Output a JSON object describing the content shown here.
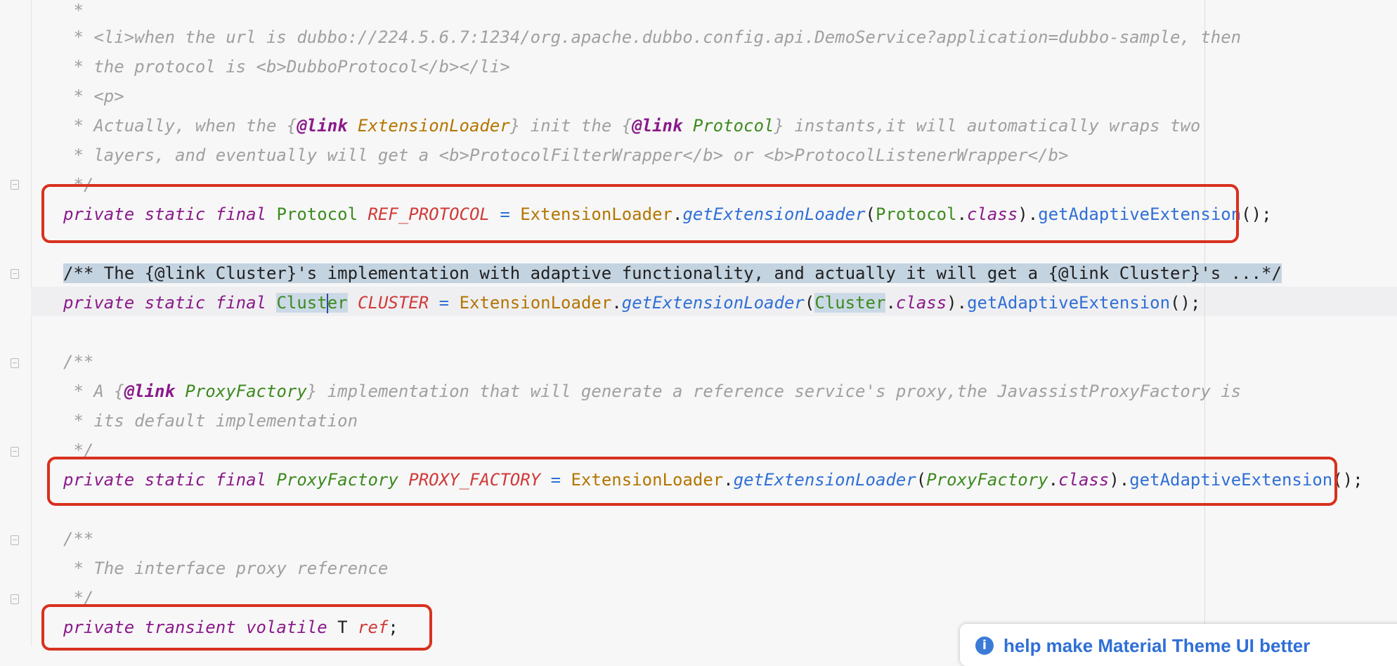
{
  "editor": {
    "lines": {
      "l1": {
        "text": " *"
      },
      "l2": {
        "text": " * <li>when the url is dubbo://224.5.6.7:1234/org.apache.dubbo.config.api.DemoService?application=dubbo-sample, then"
      },
      "l3": {
        "text": " * the protocol is <b>DubboProtocol</b></li>"
      },
      "l4": {
        "text": " * <p>"
      },
      "l5": {
        "a": " * Actually, when the {",
        "link1": "@link",
        "cls1": " ExtensionLoader",
        "b": "} init the {",
        "link2": "@link",
        "cls2": " Protocol",
        "c": "} instants,it will automatically wraps two"
      },
      "l6": {
        "text": " * layers, and eventually will get a <b>ProtocolFilterWrapper</b> or <b>ProtocolListenerWrapper</b>"
      },
      "l7": {
        "text": " */"
      },
      "l8": {
        "kw": "private static final",
        "type": "Protocol",
        "const": "REF_PROTOCOL",
        "eq": "=",
        "cls": "ExtensionLoader",
        "dot1": ".",
        "m1": "getExtensionLoader",
        "lp": "(",
        "arg": "Protocol",
        "dot2": ".",
        "classkw": "class",
        "rp": ")",
        "dot3": ".",
        "m2": "getAdaptiveExtension",
        "end": "();"
      },
      "l9": {
        "text": "/** The {@link Cluster}'s implementation with adaptive functionality, and actually it will get a {@link Cluster}'s ...*/"
      },
      "l10": {
        "kw": "private static final",
        "type_a": "Clust",
        "type_b": "er",
        "const": "CLUSTER",
        "eq": "=",
        "cls": "ExtensionLoader",
        "dot1": ".",
        "m1": "getExtensionLoader",
        "lp": "(",
        "arg": "Cluster",
        "dot2": ".",
        "classkw": "class",
        "rp": ")",
        "dot3": ".",
        "m2": "getAdaptiveExtension",
        "end": "();"
      },
      "l11": {
        "text": "/**"
      },
      "l12": {
        "a": " * A {",
        "link": "@link",
        "cls": " ProxyFactory",
        "b": "} implementation that will generate a reference service's proxy,the JavassistProxyFactory is"
      },
      "l13": {
        "text": " * its default implementation"
      },
      "l14": {
        "text": " */"
      },
      "l15": {
        "kw": "private static final",
        "type": "ProxyFactory",
        "const": "PROXY_FACTORY",
        "eq": "=",
        "cls": "ExtensionLoader",
        "dot1": ".",
        "m1": "getExtensionLoader",
        "lp": "(",
        "arg": "ProxyFactory",
        "dot2": ".",
        "classkw": "class",
        "rp": ")",
        "dot3": ".",
        "m2": "getAdaptiveExtension",
        "end": "();"
      },
      "l16": {
        "text": "/**"
      },
      "l17": {
        "text": " * The interface proxy reference"
      },
      "l18": {
        "text": " */"
      },
      "l19": {
        "kw": "private transient volatile",
        "type": "T",
        "name": "ref",
        "end": ";"
      }
    }
  },
  "notification": {
    "icon": "info-icon",
    "text": "help make Material Theme UI better"
  },
  "colors": {
    "highlight_box": "#d8311f",
    "keyword": "#8a1a8a",
    "type": "#3d8a1f",
    "constant": "#d03a3a",
    "method": "#2f6fd6",
    "comment": "#a0a0a0"
  }
}
